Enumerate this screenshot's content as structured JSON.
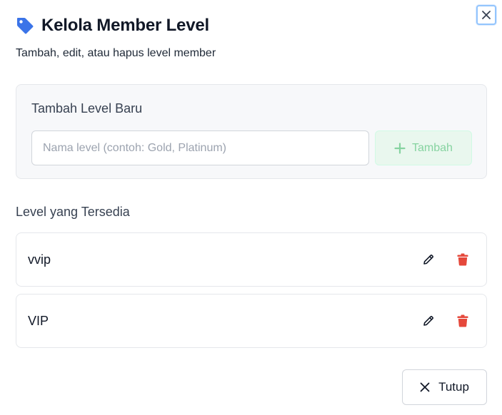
{
  "dialog": {
    "title": "Kelola Member Level",
    "subtitle": "Tambah, edit, atau hapus level member",
    "title_icon": "tag-icon",
    "close_icon": "close-icon"
  },
  "add_section": {
    "title": "Tambah Level Baru",
    "input_placeholder": "Nama level (contoh: Gold, Platinum)",
    "input_value": "",
    "add_button_label": "Tambah",
    "add_button_icon": "plus-icon"
  },
  "levels_section": {
    "title": "Level yang Tersedia",
    "items": [
      {
        "name": "vvip"
      },
      {
        "name": "VIP"
      }
    ],
    "edit_icon": "pencil-icon",
    "delete_icon": "trash-icon"
  },
  "footer": {
    "close_button_label": "Tutup",
    "close_button_icon": "close-icon"
  },
  "colors": {
    "accent_blue": "#3b74e8",
    "delete_red": "#e5483b",
    "add_green_disabled": "#86d3a0"
  }
}
